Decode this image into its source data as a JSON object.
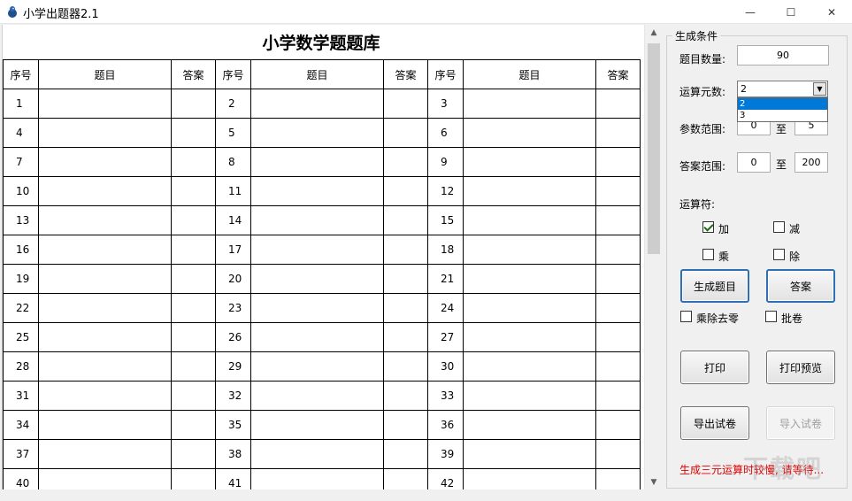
{
  "window": {
    "title": "小学出题器2.1",
    "min_glyph": "—",
    "max_glyph": "☐",
    "close_glyph": "✕"
  },
  "sheet": {
    "title": "小学数学题题库",
    "headers": [
      "序号",
      "题目",
      "答案",
      "序号",
      "题目",
      "答案",
      "序号",
      "题目",
      "答案"
    ],
    "rows": [
      [
        1,
        2,
        3
      ],
      [
        4,
        5,
        6
      ],
      [
        7,
        8,
        9
      ],
      [
        10,
        11,
        12
      ],
      [
        13,
        14,
        15
      ],
      [
        16,
        17,
        18
      ],
      [
        19,
        20,
        21
      ],
      [
        22,
        23,
        24
      ],
      [
        25,
        26,
        27
      ],
      [
        28,
        29,
        30
      ],
      [
        31,
        32,
        33
      ],
      [
        34,
        35,
        36
      ],
      [
        37,
        38,
        39
      ],
      [
        40,
        41,
        42
      ]
    ]
  },
  "panel": {
    "group_label": "生成条件",
    "count_label": "题目数量:",
    "count_value": "90",
    "operands_label": "运算元数:",
    "operands_value": "2",
    "operands_options": [
      "2",
      "3"
    ],
    "param_label": "参数范围:",
    "param_min": "0",
    "param_to": "至",
    "param_max": "5",
    "answer_label": "答案范围:",
    "answer_min": "0",
    "answer_to": "至",
    "answer_max": "200",
    "operators_label": "运算符:",
    "op_add": "加",
    "op_sub": "减",
    "op_mul": "乘",
    "op_div": "除",
    "generate_btn": "生成题目",
    "answer_btn": "答案",
    "remove_zero": "乘除去零",
    "grade": "批卷",
    "print_btn": "打印",
    "preview_btn": "打印预览",
    "export_btn": "导出试卷",
    "import_btn": "导入试卷",
    "status": "生成三元运算时较慢, 请等待...",
    "watermark": "下载吧"
  },
  "states": {
    "add_checked": true,
    "sub_checked": false,
    "mul_checked": false,
    "div_checked": false,
    "remove_zero_checked": false,
    "grade_checked": false
  },
  "colors": {
    "status_red": "#e00000",
    "selection_blue": "#0078d7",
    "button_border_blue": "#2f6fb5"
  }
}
